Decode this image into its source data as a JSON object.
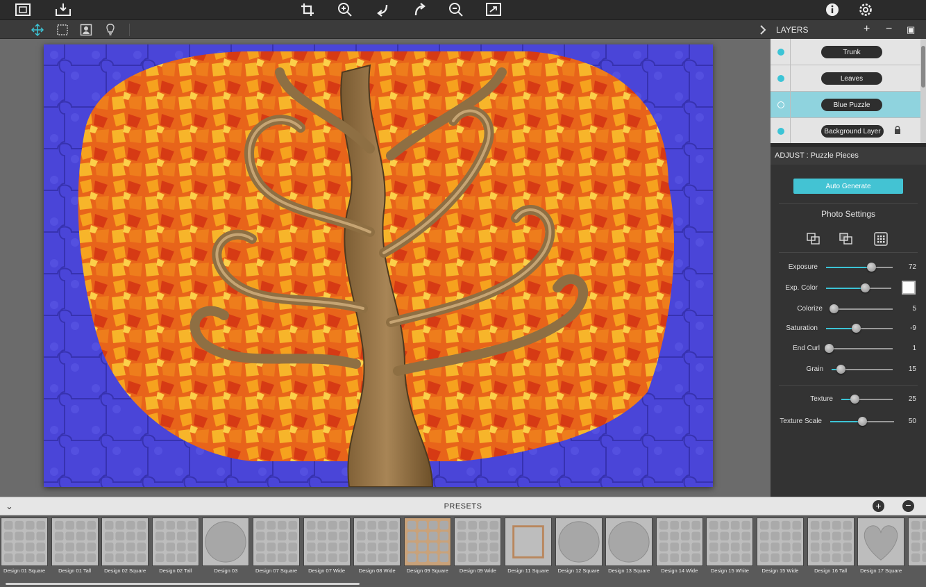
{
  "toolbar": {
    "left": [
      "image-frame-icon",
      "import-icon"
    ],
    "center": [
      "crop-icon",
      "zoom-in-icon",
      "undo-icon",
      "redo-icon",
      "zoom-out-icon",
      "fit-icon"
    ],
    "right": [
      "info-icon",
      "settings-icon"
    ]
  },
  "tools": [
    "move-icon",
    "select-rect-icon",
    "mask-icon",
    "light-icon"
  ],
  "layers": {
    "title": "LAYERS",
    "items": [
      {
        "name": "Trunk",
        "active": false,
        "locked": false
      },
      {
        "name": "Leaves",
        "active": false,
        "locked": false
      },
      {
        "name": "Blue Puzzle",
        "active": true,
        "locked": false
      },
      {
        "name": "Background Layer",
        "active": false,
        "locked": true
      }
    ]
  },
  "adjust": {
    "title": "ADJUST : Puzzle Pieces",
    "auto_generate": "Auto Generate",
    "photo_settings": "Photo Settings",
    "sliders": [
      {
        "label": "Exposure",
        "value": "72",
        "fraction": 0.68
      },
      {
        "label": "Exp. Color",
        "value": "",
        "fraction": 0.6
      },
      {
        "label": "Colorize",
        "value": "5",
        "fraction": 0.05
      },
      {
        "label": "Saturation",
        "value": "-9",
        "fraction": 0.45
      },
      {
        "label": "End Curl",
        "value": "1",
        "fraction": 0.01
      },
      {
        "label": "Grain",
        "value": "15",
        "fraction": 0.15
      },
      {
        "label": "Texture",
        "value": "25",
        "fraction": 0.25
      },
      {
        "label": "Texture Scale",
        "value": "50",
        "fraction": 0.5
      }
    ],
    "exp_color_swatch": "#ffffff",
    "accent": "#3cc4d6"
  },
  "presets": {
    "title": "PRESETS",
    "items": [
      "Design 01 Square",
      "Design 01 Tall",
      "Design 02 Square",
      "Design 02 Tall",
      "Design 03",
      "Design 07 Square",
      "Design 07 Wide",
      "Design 08 Wide",
      "Design 09 Square",
      "Design 09 Wide",
      "Design 11 Square",
      "Design 12 Square",
      "Design 13 Square",
      "Design 14 Wide",
      "Design 15 White",
      "Design 15 Wide",
      "Design 16 Tall",
      "Design 17 Square",
      ""
    ]
  }
}
